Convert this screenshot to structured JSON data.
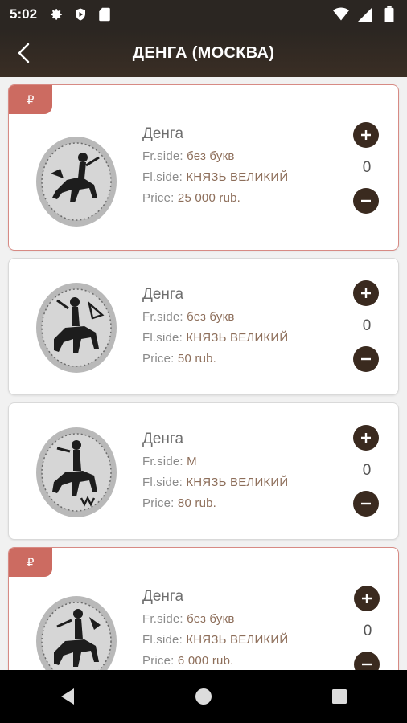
{
  "status_bar": {
    "time": "5:02",
    "icons_left": [
      "gear-icon",
      "shield-play-icon",
      "sd-card-icon"
    ],
    "icons_right": [
      "wifi-icon",
      "signal-icon",
      "battery-icon"
    ]
  },
  "app_bar": {
    "title": "ДЕНГА (МОСКВА)",
    "back_icon": "chevron-left-icon"
  },
  "labels": {
    "front_side": "Fr.side: ",
    "flip_side": "Fl.side: ",
    "price": "Price: "
  },
  "items": [
    {
      "featured": true,
      "badge": "₽",
      "name": "Денга",
      "front": "без букв",
      "flip": "КНЯЗЬ ВЕЛИКИЙ",
      "price": "25 000 rub.",
      "quantity": "0"
    },
    {
      "featured": false,
      "badge": "",
      "name": "Денга",
      "front": "без букв",
      "flip": "КНЯЗЬ ВЕЛИКИЙ",
      "price": "50 rub.",
      "quantity": "0"
    },
    {
      "featured": false,
      "badge": "",
      "name": "Денга",
      "front": "М",
      "flip": "КНЯЗЬ ВЕЛИКИЙ",
      "price": "80 rub.",
      "quantity": "0"
    },
    {
      "featured": true,
      "badge": "₽",
      "name": "Денга",
      "front": "без букв",
      "flip": "КНЯЗЬ ВЕЛИКИЙ",
      "price": "6 000 rub.",
      "quantity": "0"
    }
  ],
  "colors": {
    "app_bar": "#2b2622",
    "accent": "#cc6b61",
    "qty_button": "#3a2a1f",
    "value_text": "#8d6e5a"
  },
  "nav_bar": {
    "buttons": [
      "back-triangle-icon",
      "home-circle-icon",
      "recents-square-icon"
    ]
  }
}
